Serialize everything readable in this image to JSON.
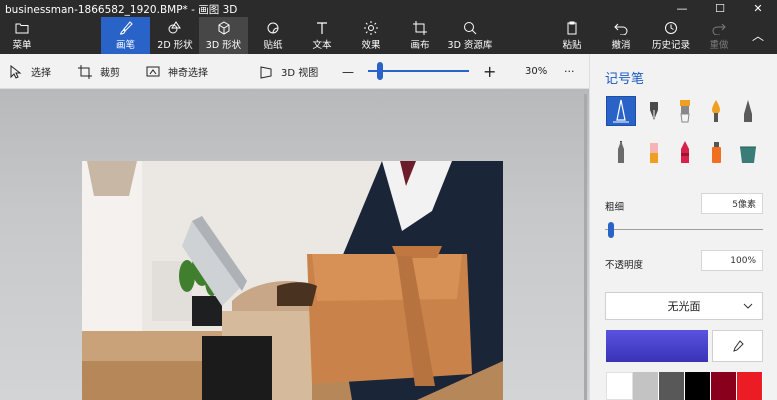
{
  "window": {
    "title": "businessman-1866582_1920.BMP* - 画图 3D",
    "min_glyph": "—",
    "max_glyph": "☐",
    "close_glyph": "✕"
  },
  "ribbon": {
    "menu": "菜单",
    "brushes": "画笔",
    "shapes2d": "2D 形状",
    "shapes3d": "3D 形状",
    "stickers": "贴纸",
    "text": "文本",
    "effects": "效果",
    "canvas": "画布",
    "library3d": "3D 资源库",
    "paste": "粘贴",
    "undo": "撤消",
    "history": "历史记录",
    "redo": "重做",
    "collapse_glyph": "︿"
  },
  "toolbar": {
    "select": "选择",
    "crop": "裁剪",
    "magic_select": "神奇选择",
    "view3d": "3D 视图",
    "zoom_out": "—",
    "zoom_in": "+",
    "zoom": "30%",
    "zoom_fraction": 0.12,
    "more": "···"
  },
  "panel": {
    "title": "记号笔",
    "thickness_label": "粗细",
    "thickness_value": "5像素",
    "thickness_fraction": 0.04,
    "opacity_label": "不透明度",
    "opacity_value": "100%",
    "finish": "无光面",
    "swatch_colors": [
      "#ffffff",
      "#c3c3c3",
      "#585858",
      "#000000",
      "#88001b",
      "#ec1c24"
    ]
  },
  "colors": {
    "accent": "#2a63c8",
    "current_color": "#4a43d0"
  }
}
